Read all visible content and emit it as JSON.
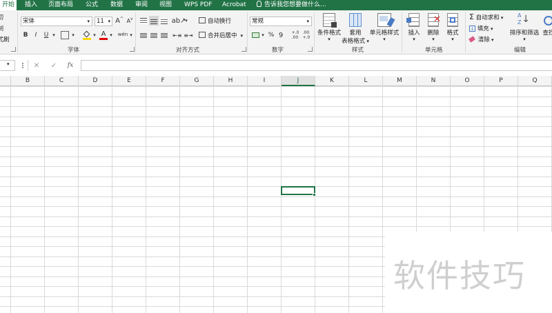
{
  "tabs": [
    {
      "label": "开始",
      "active": true
    },
    {
      "label": "插入"
    },
    {
      "label": "页面布局"
    },
    {
      "label": "公式"
    },
    {
      "label": "数据"
    },
    {
      "label": "审阅"
    },
    {
      "label": "视图"
    },
    {
      "label": "WPS PDF"
    },
    {
      "label": "Acrobat"
    }
  ],
  "tell_me": "告诉我您想要做什么...",
  "clipboard": {
    "cut": "剪切",
    "copy": "复制",
    "format_painter": "格式刷"
  },
  "font": {
    "name": "宋体",
    "size": "11",
    "bold": "B",
    "italic": "I",
    "underline": "U",
    "grow": "A",
    "shrink": "A",
    "phonetic": "wén",
    "group_label": "字体"
  },
  "alignment": {
    "wrap_text": "自动换行",
    "merge_center": "合并后居中",
    "group_label": "对齐方式"
  },
  "number": {
    "format": "常规",
    "percent": "%",
    "comma": "9",
    "inc_decimal": "+.0\n.00",
    "dec_decimal": ".00\n+.0",
    "group_label": "数字"
  },
  "styles": {
    "conditional": "条件格式",
    "table_format_1": "套用",
    "table_format_2": "表格格式",
    "cell_styles": "单元格样式",
    "group_label": "样式"
  },
  "cells": {
    "insert": "插入",
    "delete": "删除",
    "format": "格式",
    "group_label": "单元格"
  },
  "editing": {
    "autosum": "自动求和",
    "fill": "填充",
    "clear": "清除",
    "sort_filter": "排序和筛选",
    "find": "查找",
    "group_label": "编辑"
  },
  "formula_bar": {
    "cancel": "✕",
    "enter": "✓",
    "fx": "fx",
    "value": ""
  },
  "columns": [
    "B",
    "C",
    "D",
    "E",
    "F",
    "G",
    "H",
    "I",
    "J",
    "K",
    "L",
    "M",
    "N",
    "O",
    "P",
    "Q"
  ],
  "active_column": "J",
  "watermark": "软件技巧",
  "colors": {
    "accent": "#217346",
    "grid_line": "#d9d9d9"
  }
}
